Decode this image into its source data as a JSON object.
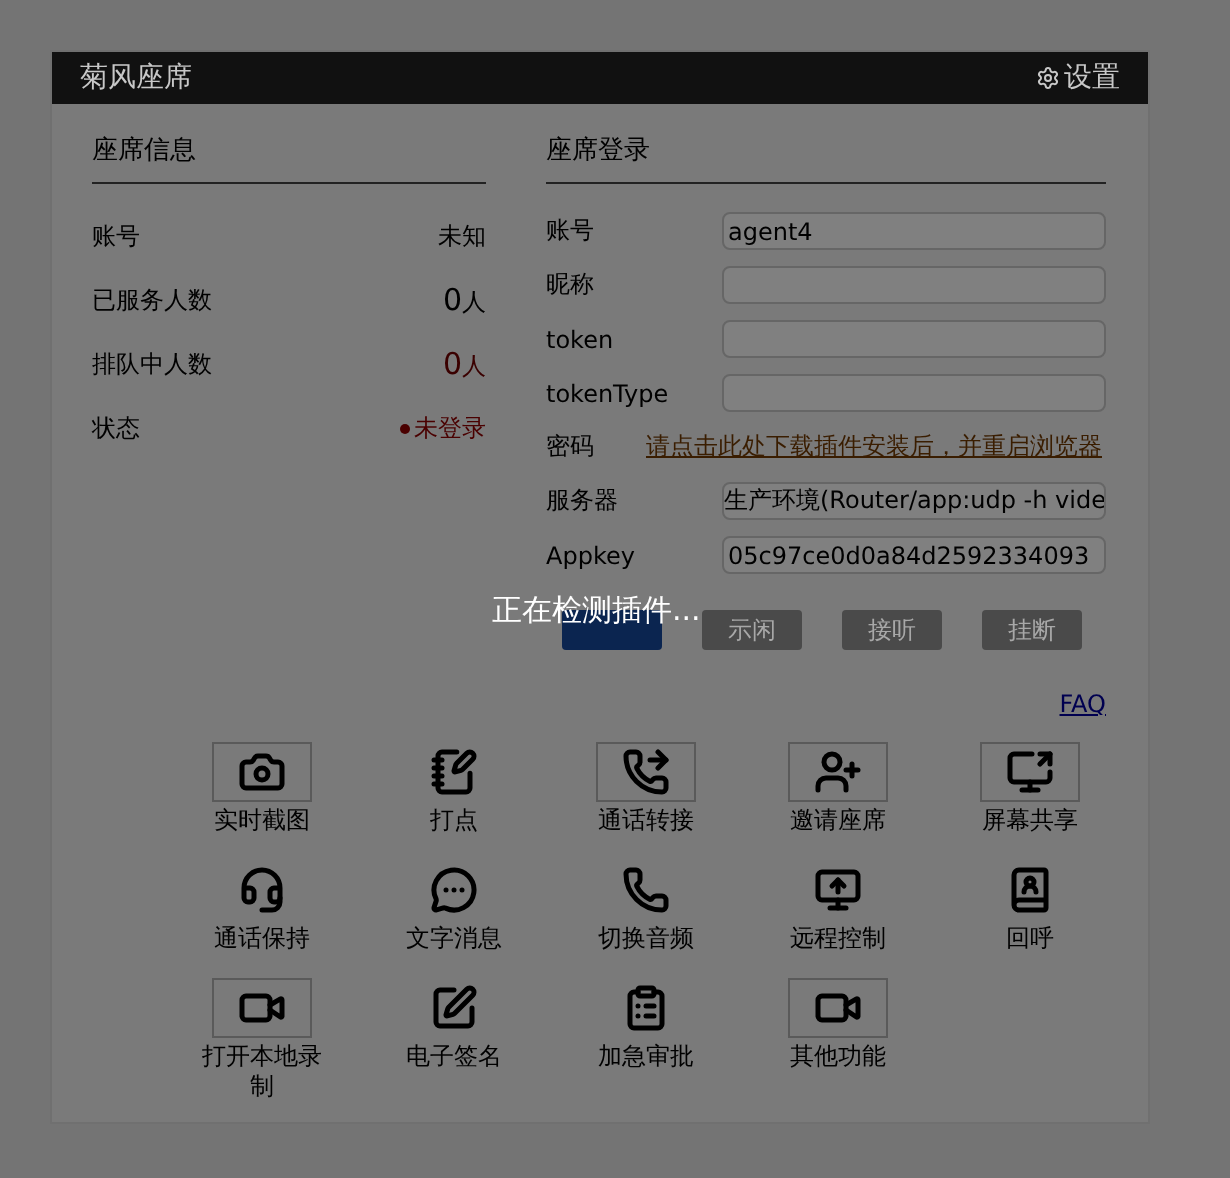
{
  "header": {
    "title": "菊风座席",
    "settings": "设置"
  },
  "info": {
    "title": "座席信息",
    "rows": [
      {
        "label": "账号",
        "value": "未知",
        "kind": "plain"
      },
      {
        "label": "已服务人数",
        "value": "0",
        "unit": "人",
        "kind": "count"
      },
      {
        "label": "排队中人数",
        "value": "0",
        "unit": "人",
        "kind": "alert"
      },
      {
        "label": "状态",
        "value": "未登录",
        "kind": "status",
        "color": "#4a0000"
      }
    ]
  },
  "login": {
    "title": "座席登录",
    "fields": [
      {
        "label": "账号",
        "kind": "input",
        "value": "agent4"
      },
      {
        "label": "昵称",
        "kind": "input"
      },
      {
        "label": "token",
        "kind": "input"
      },
      {
        "label": "tokenType",
        "kind": "input"
      },
      {
        "label": "密码",
        "kind": "link",
        "value": "请点击此处下载插件安装后，并重启浏览器"
      },
      {
        "label": "服务器",
        "kind": "select",
        "value": "生产环境(Router/app:udp -h vide"
      },
      {
        "label": "Appkey",
        "kind": "input",
        "value": "05c97ce0d0a84d2592334093"
      }
    ],
    "buttons": [
      {
        "kind": "primary",
        "disabled": false
      },
      {
        "kind": "plain",
        "label": "示闲",
        "disabled": true
      },
      {
        "kind": "plain",
        "label": "接听",
        "disabled": true
      },
      {
        "kind": "plain",
        "label": "挂断",
        "disabled": true
      }
    ],
    "faq": "FAQ"
  },
  "tools": [
    {
      "label": "实时截图",
      "framed": true
    },
    {
      "label": "打点",
      "framed": false
    },
    {
      "label": "通话转接",
      "framed": true
    },
    {
      "label": "邀请座席",
      "framed": true
    },
    {
      "label": "屏幕共享",
      "framed": true
    },
    {
      "label": "通话保持",
      "framed": false
    },
    {
      "label": "文字消息",
      "framed": false
    },
    {
      "label": "切换音频",
      "framed": false
    },
    {
      "label": "远程控制",
      "framed": false
    },
    {
      "label": "回呼",
      "framed": false
    },
    {
      "label": "打开本地录制",
      "framed": true
    },
    {
      "label": "电子签名",
      "framed": false
    },
    {
      "label": "加急审批",
      "framed": false
    },
    {
      "label": "其他功能",
      "framed": true
    }
  ],
  "overlay": {
    "text": "正在检测插件..."
  }
}
